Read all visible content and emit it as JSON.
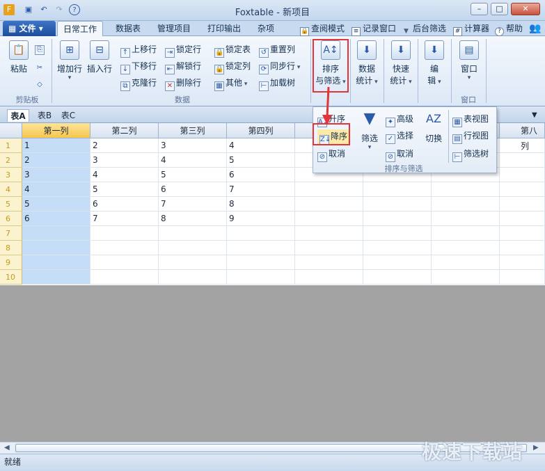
{
  "window": {
    "title": "Foxtable - 新项目",
    "minimize": "–",
    "restore": "□",
    "close": "✕"
  },
  "menu": {
    "file_label": "文件",
    "tabs": [
      "日常工作",
      "数据表",
      "管理项目",
      "打印输出",
      "杂项"
    ],
    "quick": [
      "查阅模式",
      "记录窗口",
      "后台筛选",
      "计算器",
      "帮助"
    ]
  },
  "ribbon": {
    "clipboard": {
      "paste": "粘贴",
      "group": "剪贴板"
    },
    "data": {
      "add_row": "增加行",
      "insert_row": "插入行",
      "move_up": "上移行",
      "move_down": "下移行",
      "clone_row": "克隆行",
      "lock_row": "锁定行",
      "unlock_row": "解锁行",
      "delete_row": "删除行",
      "lock_table": "锁定表",
      "lock_col": "锁定列",
      "other": "其他",
      "reset_col": "重置列",
      "sync_row": "同步行",
      "load_tree": "加载树",
      "group": "数据"
    },
    "sort_filter": {
      "line1": "排序",
      "line2": "与筛选"
    },
    "stats": {
      "line1": "数据",
      "line2": "统计"
    },
    "quick_stats": {
      "line1": "快速",
      "line2": "统计"
    },
    "edit": {
      "label": "编",
      "label2": "辑"
    },
    "window": {
      "label": "窗口",
      "group": "窗口"
    }
  },
  "popup": {
    "ascending": "升序",
    "descending": "降序",
    "cancel": "取消",
    "filter": "筛选",
    "advanced": "高级",
    "select": "选择",
    "cancel2": "取消",
    "switch": "切换",
    "table_view": "表视图",
    "row_view": "行视图",
    "filter_tree": "筛选树",
    "group": "排序与筛选"
  },
  "sheets": [
    "表A",
    "表B",
    "表C"
  ],
  "grid": {
    "columns": [
      "第一列",
      "第二列",
      "第三列",
      "第四列",
      "第八列"
    ],
    "row_numbers": [
      "1",
      "2",
      "3",
      "4",
      "5",
      "6",
      "7",
      "8",
      "9",
      "10"
    ],
    "rows": [
      [
        "1",
        "2",
        "3",
        "4"
      ],
      [
        "2",
        "3",
        "4",
        "5"
      ],
      [
        "3",
        "4",
        "5",
        "6"
      ],
      [
        "4",
        "5",
        "6",
        "7"
      ],
      [
        "5",
        "6",
        "7",
        "8"
      ],
      [
        "6",
        "7",
        "8",
        "9"
      ]
    ]
  },
  "status": "就绪",
  "watermark": "极速下载站",
  "colors": {
    "accent": "#2a5aa8",
    "highlight": "#e3343a",
    "selected_col": "#c5ddf6"
  }
}
